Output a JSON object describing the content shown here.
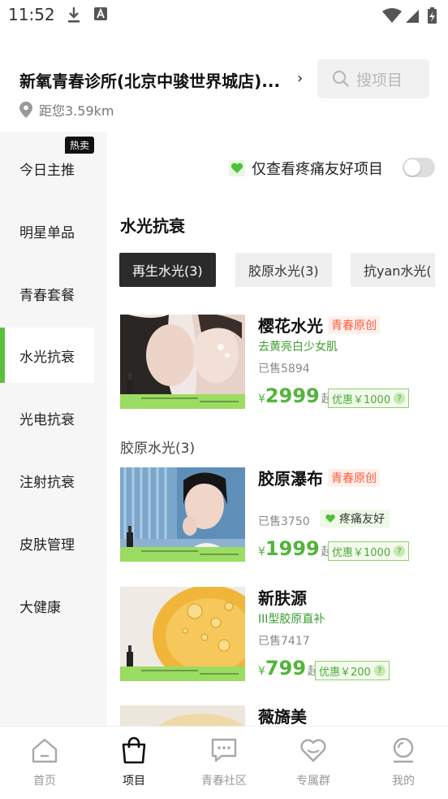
{
  "status_bar": {
    "time": "11:52"
  },
  "header": {
    "store_name": "新氧青春诊所(北京中骏世界城店)...",
    "distance": "距您3.59km",
    "search_placeholder": "搜项目"
  },
  "sidebar": {
    "hot_badge": "热卖",
    "items": [
      {
        "label": "今日主推"
      },
      {
        "label": "明星单品"
      },
      {
        "label": "青春套餐"
      },
      {
        "label": "水光抗衰"
      },
      {
        "label": "光电抗衰"
      },
      {
        "label": "注射抗衰"
      },
      {
        "label": "皮肤管理"
      },
      {
        "label": "大健康"
      }
    ],
    "active_index": 3
  },
  "filter": {
    "pain_friendly_label": "仅查看疼痛友好项目",
    "pain_friendly_on": false
  },
  "section": {
    "title": "水光抗衰",
    "chips": [
      {
        "label": "再生水光(3)"
      },
      {
        "label": "胶原水光(3)"
      },
      {
        "label": "抗yan水光("
      }
    ],
    "active_chip": 0,
    "subsection_title": "胶原水光(3)"
  },
  "products": [
    {
      "name": "樱花水光",
      "tag": "青春原创",
      "subtitle": "去黄亮白少女肌",
      "sold": "已售5894",
      "currency": "¥",
      "price": "2999",
      "price_suffix": "起",
      "coupon": "优惠￥1000",
      "coupon_help": "?"
    },
    {
      "name": "胶原瀑布",
      "tag": "青春原创",
      "sold": "已售3750",
      "pain_tag": "疼痛友好",
      "currency": "¥",
      "price": "1999",
      "price_suffix": "起",
      "coupon": "优惠￥1000",
      "coupon_help": "?"
    },
    {
      "name": "新肤源",
      "subtitle": "III型胶原直补",
      "sold": "已售7417",
      "currency": "¥",
      "price": "799",
      "price_suffix": "起",
      "coupon": "优惠￥200",
      "coupon_help": "?"
    },
    {
      "name": "薇旖美"
    }
  ],
  "tabbar": {
    "items": [
      {
        "label": "首页",
        "icon": "home-icon"
      },
      {
        "label": "项目",
        "icon": "shopping-bag-icon"
      },
      {
        "label": "青春社区",
        "icon": "chat-icon"
      },
      {
        "label": "专属群",
        "icon": "heart-group-icon"
      },
      {
        "label": "我的",
        "icon": "profile-icon"
      }
    ],
    "active_index": 1
  },
  "colors": {
    "accent_green": "#5cbf3c",
    "original_tag": "#ff5a3a"
  }
}
